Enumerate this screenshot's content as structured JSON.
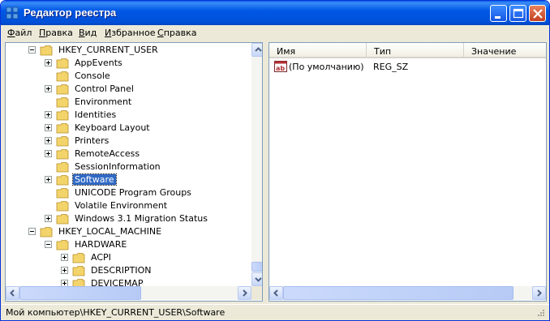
{
  "window": {
    "title": "Редактор реестра"
  },
  "menu": [
    {
      "hotkey": "Ф",
      "rest": "айл"
    },
    {
      "hotkey": "П",
      "rest": "равка"
    },
    {
      "hotkey": "В",
      "rest": "ид"
    },
    {
      "hotkey": "И",
      "rest": "збранное"
    },
    {
      "hotkey": "С",
      "rest": "правка"
    }
  ],
  "tree": [
    {
      "label": "HKEY_CURRENT_USER",
      "expander": "minus"
    },
    {
      "label": "AppEvents",
      "expander": "plus"
    },
    {
      "label": "Console",
      "expander": "none"
    },
    {
      "label": "Control Panel",
      "expander": "plus"
    },
    {
      "label": "Environment",
      "expander": "none"
    },
    {
      "label": "Identities",
      "expander": "plus"
    },
    {
      "label": "Keyboard Layout",
      "expander": "plus"
    },
    {
      "label": "Printers",
      "expander": "plus"
    },
    {
      "label": "RemoteAccess",
      "expander": "plus"
    },
    {
      "label": "SessionInformation",
      "expander": "none"
    },
    {
      "label": "Software",
      "expander": "plus",
      "selected": true
    },
    {
      "label": "UNICODE Program Groups",
      "expander": "none"
    },
    {
      "label": "Volatile Environment",
      "expander": "none"
    },
    {
      "label": "Windows 3.1 Migration Status",
      "expander": "plus"
    },
    {
      "label": "HKEY_LOCAL_MACHINE",
      "expander": "minus"
    },
    {
      "label": "HARDWARE",
      "expander": "minus"
    },
    {
      "label": "ACPI",
      "expander": "plus"
    },
    {
      "label": "DESCRIPTION",
      "expander": "plus"
    },
    {
      "label": "DEVICEMAP",
      "expander": "plus"
    }
  ],
  "list": {
    "columns": [
      "Имя",
      "Тип",
      "Значение"
    ],
    "rows": [
      {
        "icon": "ab-string-icon",
        "name": "(По умолчанию)",
        "type": "REG_SZ",
        "value": ""
      }
    ]
  },
  "status": {
    "path": "Мой компьютер\\HKEY_CURRENT_USER\\Software"
  },
  "colors": {
    "titlebar": "#0058e6",
    "selection": "#316ac5",
    "folder": "#f3d46b"
  }
}
